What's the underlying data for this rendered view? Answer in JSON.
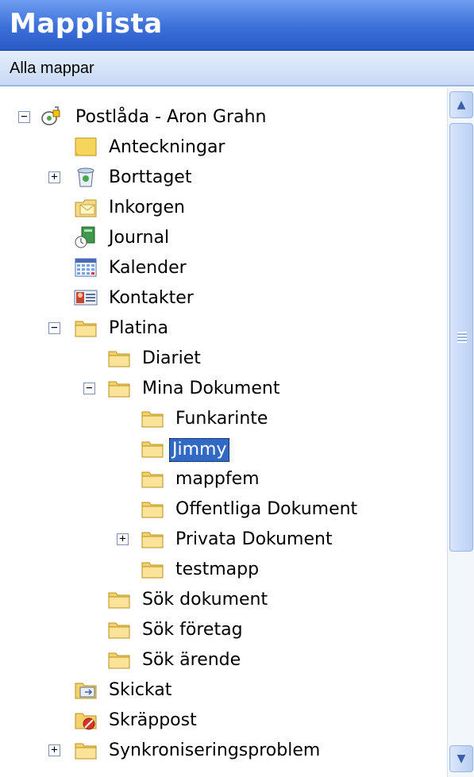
{
  "header": {
    "title": "Mapplista"
  },
  "subheader": {
    "label": "Alla mappar"
  },
  "tree": {
    "root": "Postlåda - Aron Grahn",
    "anteckningar": "Anteckningar",
    "borttaget": "Borttaget",
    "inkorgen": "Inkorgen",
    "journal": "Journal",
    "kalender": "Kalender",
    "kontakter": "Kontakter",
    "platina": "Platina",
    "diariet": "Diariet",
    "mina_dokument": "Mina Dokument",
    "funkarinte": "Funkarinte",
    "jimmy": "Jimmy",
    "mappfem": "mappfem",
    "offentliga": "Offentliga Dokument",
    "privata": "Privata Dokument",
    "testmapp": "testmapp",
    "sok_dokument": "Sök dokument",
    "sok_foretag": "Sök företag",
    "sok_arende": "Sök ärende",
    "skickat": "Skickat",
    "skrappost": "Skräppost",
    "synkronisering": "Synkroniseringsproblem"
  },
  "expanders": {
    "collapse": "−",
    "expand": "+"
  },
  "scrollbar": {
    "up": "▲",
    "down": "▼"
  },
  "colors": {
    "selection": "#316ac5",
    "header": "#3b6fd8"
  }
}
